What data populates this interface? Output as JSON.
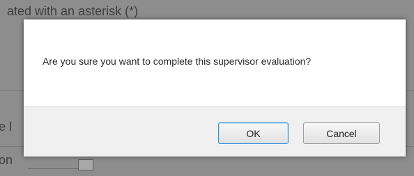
{
  "background": {
    "top_text": "ated with an asterisk (*)",
    "left_fragment_1": "e l",
    "left_fragment_2": "on"
  },
  "dialog": {
    "message": "Are you sure you want to complete this supervisor evaluation?",
    "ok_label": "OK",
    "cancel_label": "Cancel"
  },
  "colors": {
    "overlay": "#8d8d8d",
    "dialog_bg": "#ffffff",
    "footer_bg": "#f0f0f0",
    "focus_border": "#3a8fd6"
  }
}
